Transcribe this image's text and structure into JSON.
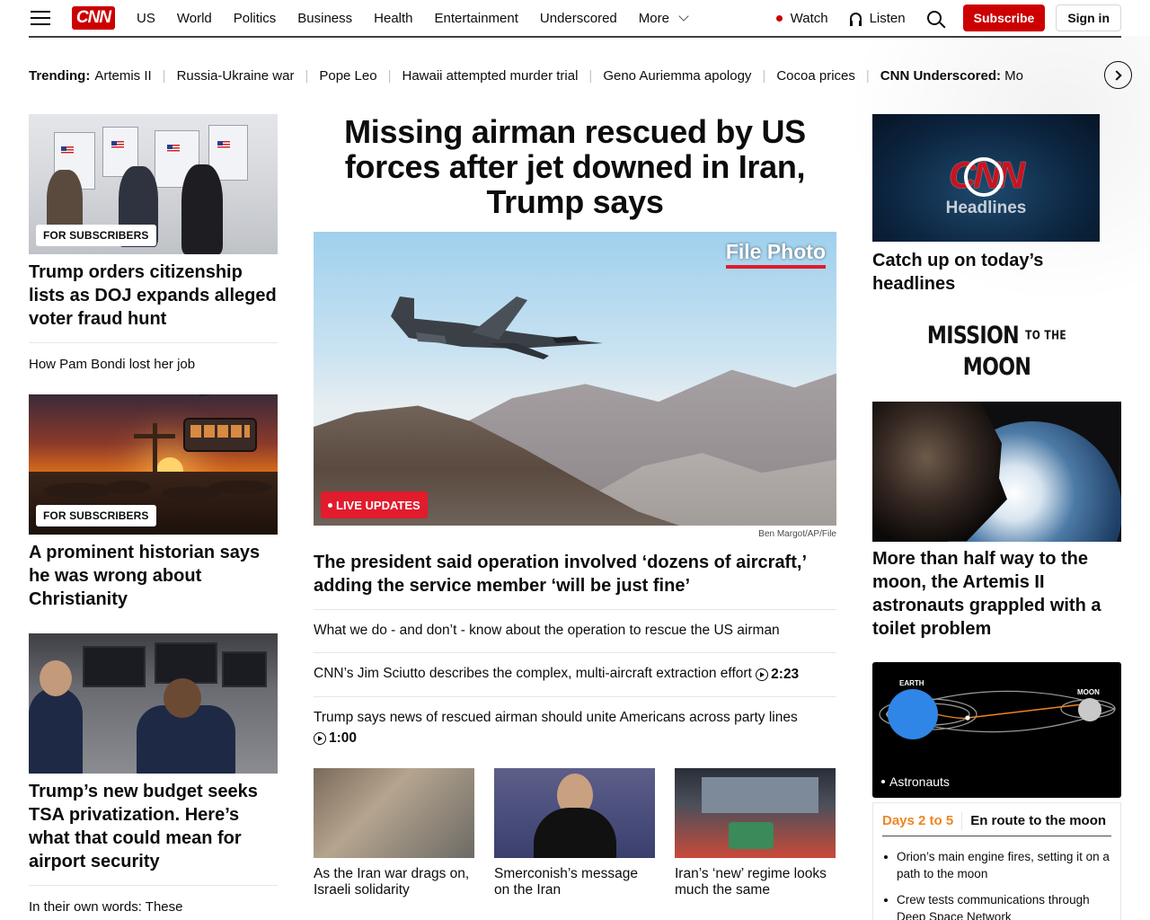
{
  "header": {
    "logo": "CNN",
    "nav": [
      "US",
      "World",
      "Politics",
      "Business",
      "Health",
      "Entertainment",
      "Underscored"
    ],
    "more": "More",
    "watch": "Watch",
    "listen": "Listen",
    "subscribe": "Subscribe",
    "sign_in": "Sign in"
  },
  "trending": {
    "label": "Trending:",
    "items": [
      "Artemis II",
      "Russia-Ukraine war",
      "Pope Leo",
      "Hawaii attempted murder trial",
      "Geno Auriemma apology",
      "Cocoa prices"
    ],
    "last_bold": "CNN Underscored:",
    "last_rest": "Mo"
  },
  "left": {
    "card1": {
      "badge": "FOR SUBSCRIBERS",
      "headline": "Trump orders citizenship lists as DOJ expands alleged voter fraud hunt"
    },
    "link1": "How Pam Bondi lost her job",
    "card2": {
      "badge": "FOR SUBSCRIBERS",
      "headline": "A prominent historian says he was wrong about Christianity"
    },
    "card3": {
      "headline": "Trump’s new budget seeks TSA privatization. Here’s what that could mean for airport security"
    },
    "link2": "In their own words: These"
  },
  "center": {
    "headline": "Missing airman rescued by US forces after jet downed in Iran, Trump says",
    "file_photo": "File Photo",
    "live_badge": "LIVE UPDATES",
    "credit": "Ben Margot/AP/File",
    "sub_headline": "The president said operation involved ‘dozens of aircraft,’ adding the service member ‘will be just fine’",
    "links": [
      {
        "text": "What we do - and don’t - know about the operation to rescue the US airman",
        "duration": ""
      },
      {
        "text": "CNN’s Jim Sciutto describes the complex, multi-aircraft extraction effort",
        "duration": "2:23"
      },
      {
        "text": "Trump says news of rescued airman should unite Americans across party lines",
        "duration": "1:00"
      }
    ],
    "thumbs": [
      "As the Iran war drags on, Israeli solidarity",
      "Smerconish’s message on the Iran",
      "Iran’s ‘new’ regime looks much the same"
    ]
  },
  "right": {
    "headlines_card": {
      "logo": "CNN",
      "word": "Headlines"
    },
    "headlines_title": "Catch up on today’s headlines",
    "mission": {
      "part1": "MISSION",
      "part2": "TO THE",
      "part3": "MOON"
    },
    "moon_headline": "More than half way to the moon, the Artemis II astronauts grappled with a toilet problem",
    "orbit": {
      "earth": "EARTH",
      "moon": "MOON",
      "astronauts": "Astronauts"
    },
    "days": {
      "range": "Days 2 to 5",
      "title": "En route to the moon",
      "items": [
        "Orion’s main engine fires, setting it on a path to the moon",
        "Crew tests communications through Deep Space Network"
      ]
    }
  }
}
